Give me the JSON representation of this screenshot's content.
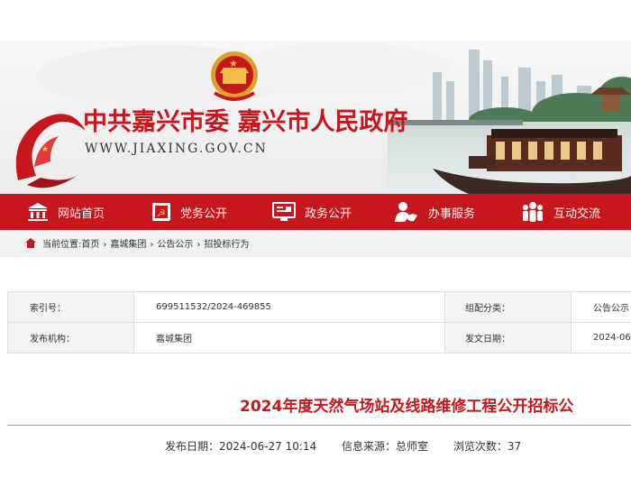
{
  "header": {
    "org_name": "中共嘉兴市委 嘉兴市人民政府",
    "site_url": "WWW.JIAXING.GOV.CN"
  },
  "nav": {
    "items": [
      {
        "label": "网站首页",
        "icon": "home-temple-icon"
      },
      {
        "label": "党务公开",
        "icon": "party-flag-icon"
      },
      {
        "label": "政务公开",
        "icon": "monitor-icon"
      },
      {
        "label": "办事服务",
        "icon": "person-service-icon"
      },
      {
        "label": "互动交流",
        "icon": "people-group-icon"
      }
    ]
  },
  "breadcrumb": {
    "prefix": "当前位置:",
    "items": [
      "首页",
      "嘉城集团",
      "公告公示",
      "招投标行为"
    ]
  },
  "meta": {
    "index_label": "索引号：",
    "index_value": "699511532/2024-469855",
    "category_label": "组配分类：",
    "category_value": "公告公示",
    "publisher_label": "发布机构：",
    "publisher_value": "嘉城集团",
    "date_label": "发文日期：",
    "date_value": "2024-06"
  },
  "article": {
    "title": "2024年度天然气场站及线路维修工程公开招标公",
    "publish_date": "发布日期：2024-06-27 10:14",
    "source": "信息来源：总师室",
    "views": "浏览次数：37"
  },
  "colors": {
    "brand_red": "#c8161d",
    "crumb_bg": "#f1f1f1",
    "label_bg": "#f3f3f3"
  }
}
